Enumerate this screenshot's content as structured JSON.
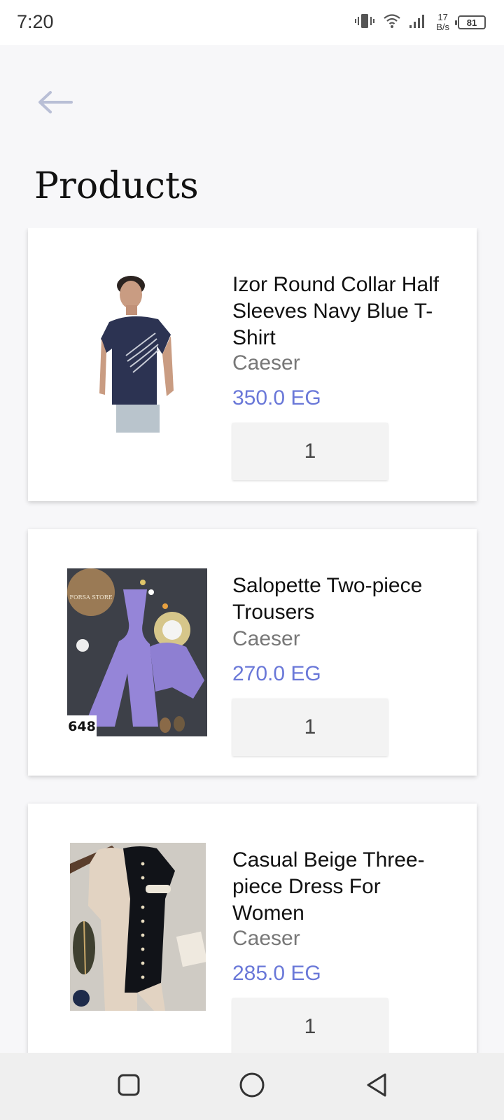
{
  "status_bar": {
    "time": "7:20",
    "net_speed_value": "17",
    "net_speed_unit": "B/s",
    "battery_level": "81"
  },
  "header": {
    "title": "Products"
  },
  "products": [
    {
      "name": "Izor Round Collar Half Sleeves Navy Blue T-Shirt",
      "brand": "Caeser",
      "price": "350.0 EG",
      "quantity": "1"
    },
    {
      "name": "Salopette Two-piece Trousers",
      "brand": "Caeser",
      "price": "270.0 EG",
      "quantity": "1",
      "image_text": "FORSA STORE",
      "image_code": "648"
    },
    {
      "name": "Casual Beige Three-piece Dress For Women",
      "brand": "Caeser",
      "price": "285.0 EG",
      "quantity": "1"
    }
  ],
  "colors": {
    "price": "#6a78d8",
    "brand": "#777777",
    "back_arrow": "#b9bfd6",
    "background": "#f7f7f9"
  },
  "icons": {
    "back": "arrow-left-icon",
    "nav_recents": "square-icon",
    "nav_home": "circle-icon",
    "nav_back": "triangle-back-icon"
  }
}
